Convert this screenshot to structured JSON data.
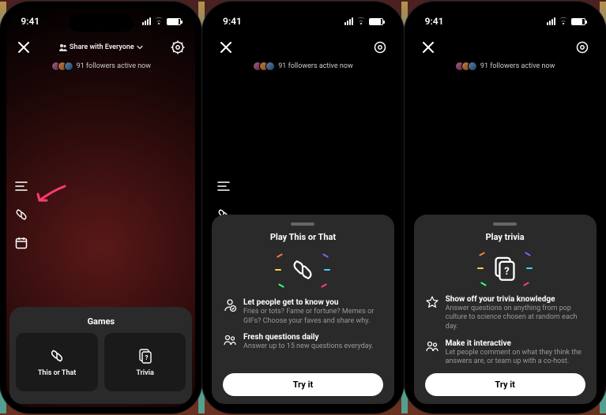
{
  "status": {
    "time": "9:41"
  },
  "header": {
    "share_label": "Share with Everyone",
    "followers": "91 followers active now"
  },
  "screen1": {
    "sheet_title": "Games",
    "cards": [
      {
        "label": "This or That"
      },
      {
        "label": "Trivia"
      }
    ]
  },
  "screen2": {
    "title": "Play This or That",
    "features": [
      {
        "title": "Let people get to know you",
        "desc": "Fries or tots? Fame or fortune? Memes or GIFs? Choose your faves and share why."
      },
      {
        "title": "Fresh questions daily",
        "desc": "Answer up to 15 new questions everyday."
      }
    ],
    "cta": "Try it"
  },
  "screen3": {
    "title": "Play trivia",
    "features": [
      {
        "title": "Show off your trivia knowledge",
        "desc": "Answer questions on anything from pop culture to science chosen at random each day."
      },
      {
        "title": "Make it interactive",
        "desc": "Let people comment on what they think the answers are, or team up with a co-host."
      }
    ],
    "cta": "Try it"
  }
}
